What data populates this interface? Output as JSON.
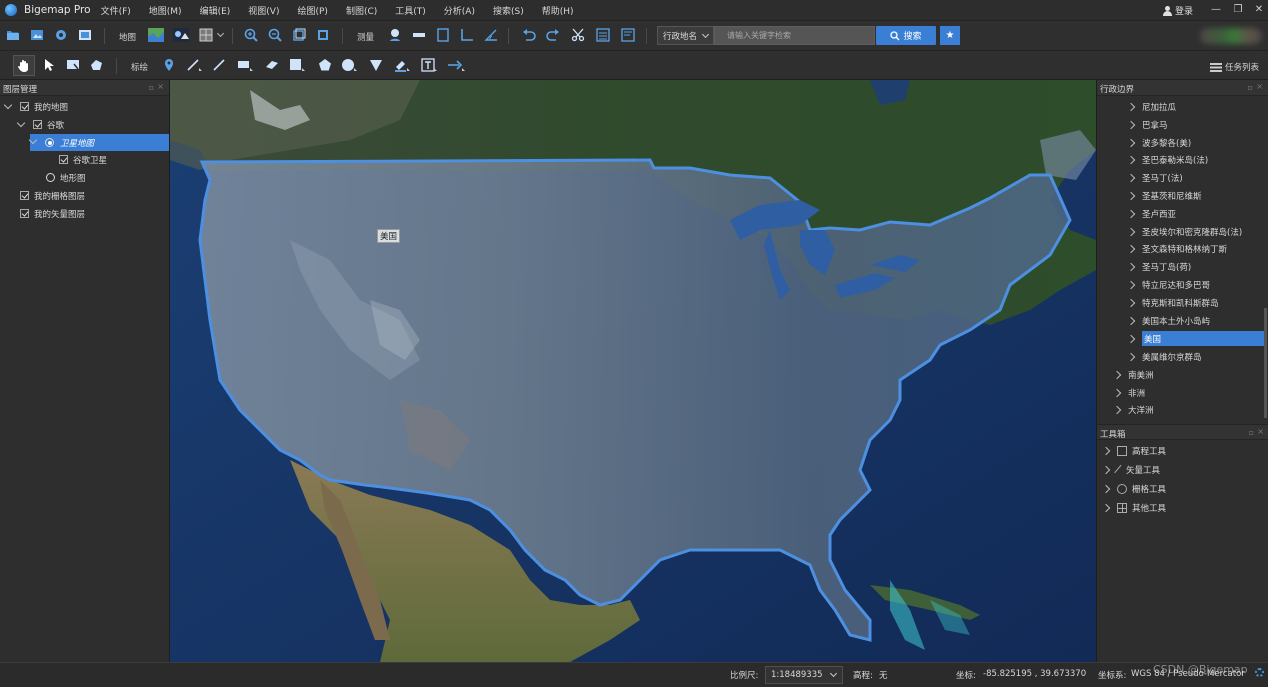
{
  "app": {
    "title": "Bigemap Pro"
  },
  "menu": [
    "文件(F)",
    "地图(M)",
    "编辑(E)",
    "视图(V)",
    "绘图(P)",
    "制图(C)",
    "工具(T)",
    "分析(A)",
    "搜索(S)",
    "帮助(H)"
  ],
  "account": {
    "login_label": "登录"
  },
  "toolbar1": {
    "map_label": "地图",
    "measure_label": "测量",
    "region_select": "行政地名",
    "search_placeholder": "请输入关键字检索",
    "search_button": "搜索"
  },
  "toolbar2": {
    "annotate_label": "标绘",
    "tasklist_label": "任务列表"
  },
  "layers_panel": {
    "title": "图层管理",
    "items": [
      {
        "label": "我的地图",
        "type": "checkbox",
        "checked": true,
        "expanded": true
      },
      {
        "label": "谷歌",
        "type": "checkbox",
        "checked": true,
        "expanded": true
      },
      {
        "label": "卫星地图",
        "type": "radio",
        "checked": true,
        "expanded": true,
        "selected": true
      },
      {
        "label": "谷歌卫星",
        "type": "checkbox",
        "checked": true
      },
      {
        "label": "地形图",
        "type": "radio",
        "checked": false
      },
      {
        "label": "我的栅格图层",
        "type": "checkbox",
        "checked": true
      },
      {
        "label": "我的矢量图层",
        "type": "checkbox",
        "checked": true
      }
    ]
  },
  "map": {
    "highlight_label": "美国",
    "highlight_color": "#4d8fe0"
  },
  "admin_panel": {
    "title": "行政边界",
    "items": [
      {
        "label": "尼加拉瓜",
        "level": 2
      },
      {
        "label": "巴拿马",
        "level": 2
      },
      {
        "label": "波多黎各(美)",
        "level": 2
      },
      {
        "label": "圣巴泰勒米岛(法)",
        "level": 2
      },
      {
        "label": "圣马丁(法)",
        "level": 2
      },
      {
        "label": "圣基茨和尼维斯",
        "level": 2
      },
      {
        "label": "圣卢西亚",
        "level": 2
      },
      {
        "label": "圣皮埃尔和密克隆群岛(法)",
        "level": 2
      },
      {
        "label": "圣文森特和格林纳丁斯",
        "level": 2
      },
      {
        "label": "圣马丁岛(荷)",
        "level": 2
      },
      {
        "label": "特立尼达和多巴哥",
        "level": 2
      },
      {
        "label": "特克斯和凯科斯群岛",
        "level": 2
      },
      {
        "label": "美国本土外小岛屿",
        "level": 2
      },
      {
        "label": "美国",
        "level": 2,
        "selected": true
      },
      {
        "label": "美属维尔京群岛",
        "level": 2
      },
      {
        "label": "南美洲",
        "level": 1
      },
      {
        "label": "非洲",
        "level": 1
      },
      {
        "label": "大洋洲",
        "level": 1
      }
    ]
  },
  "toolbox": {
    "title": "工具箱",
    "items": [
      {
        "label": "高程工具",
        "icon": "elevation-icon"
      },
      {
        "label": "矢量工具",
        "icon": "pen-icon"
      },
      {
        "label": "栅格工具",
        "icon": "raster-icon"
      },
      {
        "label": "其他工具",
        "icon": "grid-icon"
      }
    ]
  },
  "status": {
    "scale_label": "比例尺:",
    "scale_value": "1:18489335",
    "elevation_label": "高程:",
    "elevation_value": "无",
    "coord_label": "坐标:",
    "coord_value": "-85.825195 , 39.673370",
    "crs_label": "坐标系:",
    "crs_value": "WGS 84 / Pseudo-Mercator",
    "watermark": "CSDN @Bigemap"
  }
}
